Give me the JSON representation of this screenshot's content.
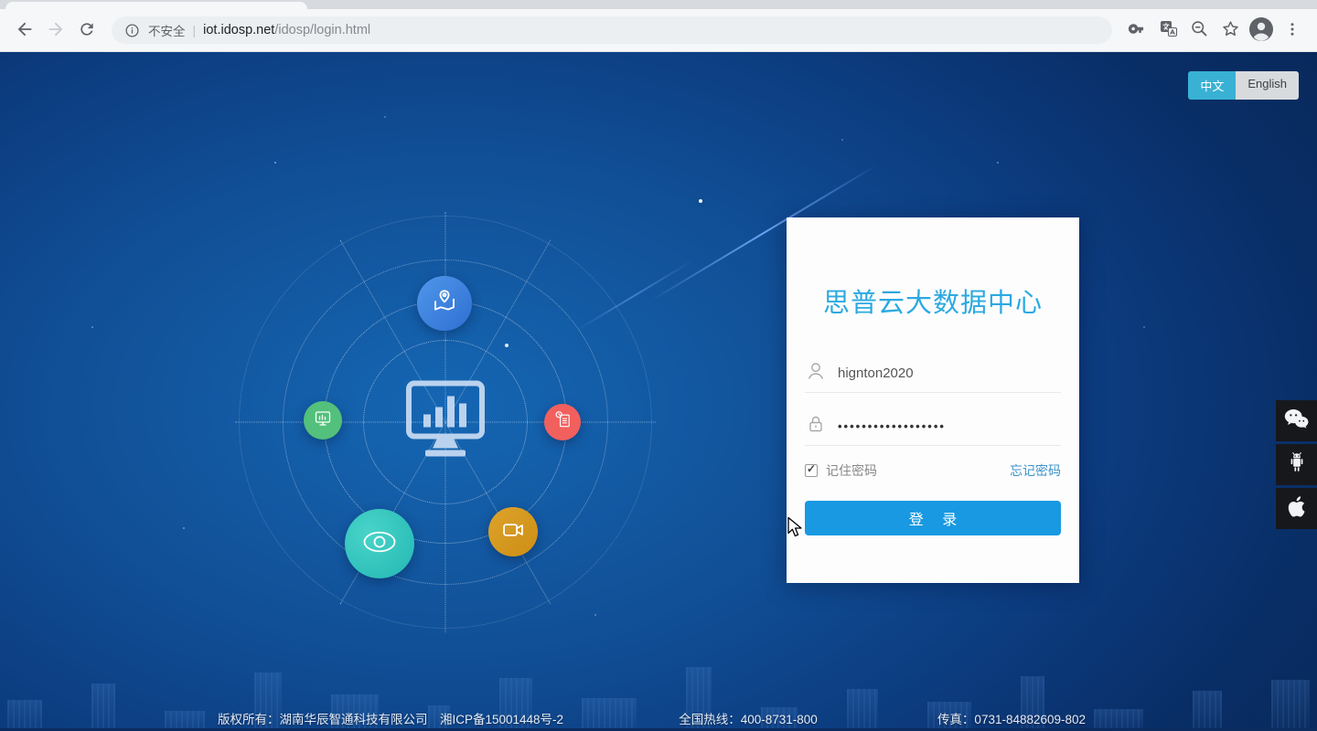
{
  "browser": {
    "security_label": "不安全",
    "url_separator": "|",
    "url_host": "iot.idosp.net",
    "url_path": "/idosp/login.html"
  },
  "lang": {
    "zh": "中文",
    "en": "English"
  },
  "login": {
    "title": "思普云大数据中心",
    "username_value": "hignton2020",
    "username_placeholder": "",
    "password_value": "••••••••••••••••••",
    "remember_label": "记住密码",
    "forgot_label": "忘记密码",
    "submit_label": "登 录"
  },
  "footer": {
    "copyright": "版权所有：湖南华辰智通科技有限公司　湘ICP备15001448号-2",
    "hotline": "全国热线：400-8731-800",
    "fax": "传真：0731-84882609-802"
  },
  "icons": {
    "browser": [
      "back-icon",
      "forward-icon",
      "refresh-icon",
      "info-icon",
      "key-icon",
      "translate-icon",
      "zoom-out-icon",
      "bookmark-star-icon",
      "profile-icon",
      "menu-dots-icon"
    ],
    "hub": [
      "map-pin-icon",
      "dashboard-monitor-icon",
      "monitor-mini-icon",
      "report-clock-icon",
      "eye-icon",
      "video-camera-icon"
    ],
    "form": [
      "user-icon",
      "lock-icon"
    ],
    "apps": [
      "wechat-icon",
      "android-icon",
      "apple-icon"
    ]
  },
  "colors": {
    "accent_button": "#1899e2",
    "title_text": "#2ba9e1",
    "lang_active_bg": "#39b1d4",
    "link_text": "#3e93c9",
    "page_bg_inner": "#1566b3",
    "page_bg_outer": "#08285a",
    "tile_bg": "#17181c"
  }
}
